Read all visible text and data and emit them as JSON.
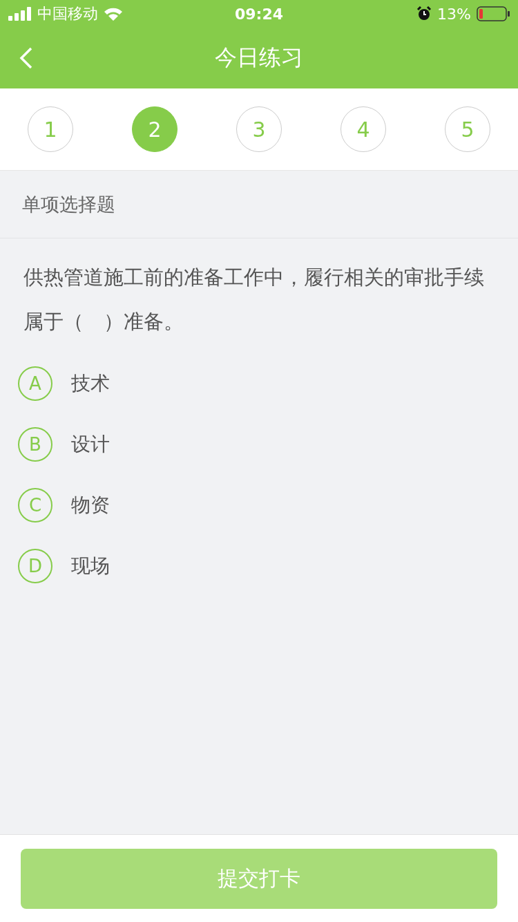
{
  "status_bar": {
    "carrier": "中国移动",
    "time": "09:24",
    "battery": "13%"
  },
  "nav": {
    "title": "今日练习"
  },
  "steps": [
    {
      "label": "1",
      "selected": false
    },
    {
      "label": "2",
      "selected": true
    },
    {
      "label": "3",
      "selected": false
    },
    {
      "label": "4",
      "selected": false
    },
    {
      "label": "5",
      "selected": false
    }
  ],
  "section_title": "单项选择题",
  "question": "供热管道施工前的准备工作中，履行相关的审批手续属于（　）准备。",
  "options": [
    {
      "letter": "A",
      "text": "技术",
      "selected": false
    },
    {
      "letter": "B",
      "text": "设计",
      "selected": false
    },
    {
      "letter": "C",
      "text": "物资",
      "selected": false
    },
    {
      "letter": "D",
      "text": "现场",
      "selected": false
    }
  ],
  "submit": {
    "label": "提交打卡",
    "disabled": true
  }
}
